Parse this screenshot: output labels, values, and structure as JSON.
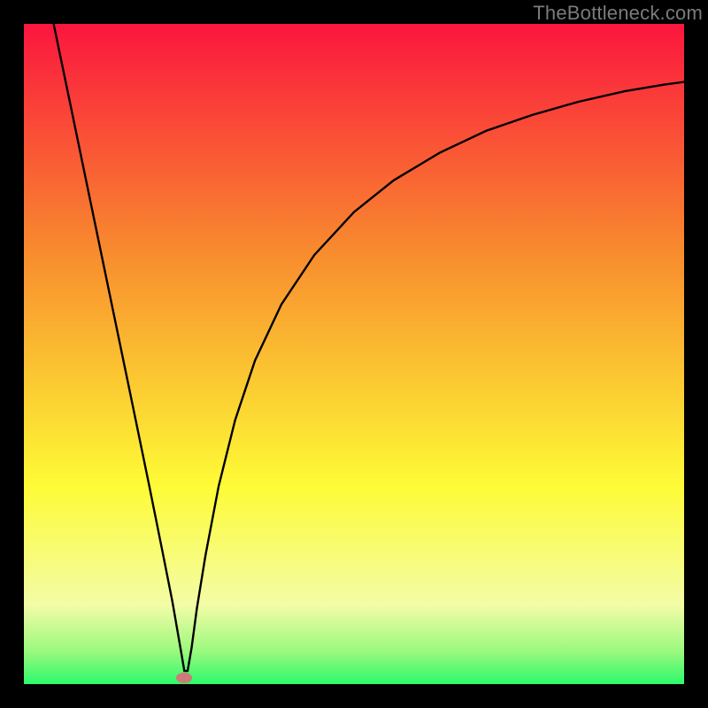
{
  "watermark": "TheBottleneck.com",
  "colors": {
    "frame": "#000000",
    "gradient_top": "#fb163e",
    "gradient_mid1": "#f88d2e",
    "gradient_mid2": "#fefb36",
    "gradient_bottom_band": "#f3fca7",
    "gradient_bottom": "#2cf96c",
    "curve": "#000000",
    "marker": "#cf7a78"
  },
  "chart_data": {
    "type": "line",
    "title": "",
    "xlabel": "",
    "ylabel": "",
    "xlim": [
      0,
      1
    ],
    "ylim": [
      0,
      1
    ],
    "gradient_stops": [
      {
        "offset": 0.0,
        "color": "#fb163e"
      },
      {
        "offset": 0.35,
        "color": "#f88d2e"
      },
      {
        "offset": 0.7,
        "color": "#fefb36"
      },
      {
        "offset": 0.88,
        "color": "#f3fca7"
      },
      {
        "offset": 0.95,
        "color": "#9bf97e"
      },
      {
        "offset": 1.0,
        "color": "#2cf96c"
      }
    ],
    "x": [
      0.045,
      0.07,
      0.1,
      0.13,
      0.16,
      0.19,
      0.21,
      0.225,
      0.238,
      0.243,
      0.248,
      0.254,
      0.262,
      0.275,
      0.295,
      0.32,
      0.35,
      0.39,
      0.44,
      0.5,
      0.56,
      0.63,
      0.7,
      0.77,
      0.84,
      0.91,
      0.97,
      1.0
    ],
    "y_bottleneck": [
      1.0,
      0.88,
      0.735,
      0.59,
      0.445,
      0.3,
      0.2,
      0.125,
      0.05,
      0.02,
      0.02,
      0.055,
      0.115,
      0.195,
      0.3,
      0.4,
      0.49,
      0.575,
      0.65,
      0.715,
      0.763,
      0.805,
      0.838,
      0.862,
      0.882,
      0.898,
      0.908,
      0.912
    ],
    "marker": {
      "x": 0.243,
      "y": 0.01
    },
    "notes": "y values are fraction of vertical extent measured from bottom (0) to top (1); curve represents bottleneck percentage with minimum near x≈0.24."
  }
}
